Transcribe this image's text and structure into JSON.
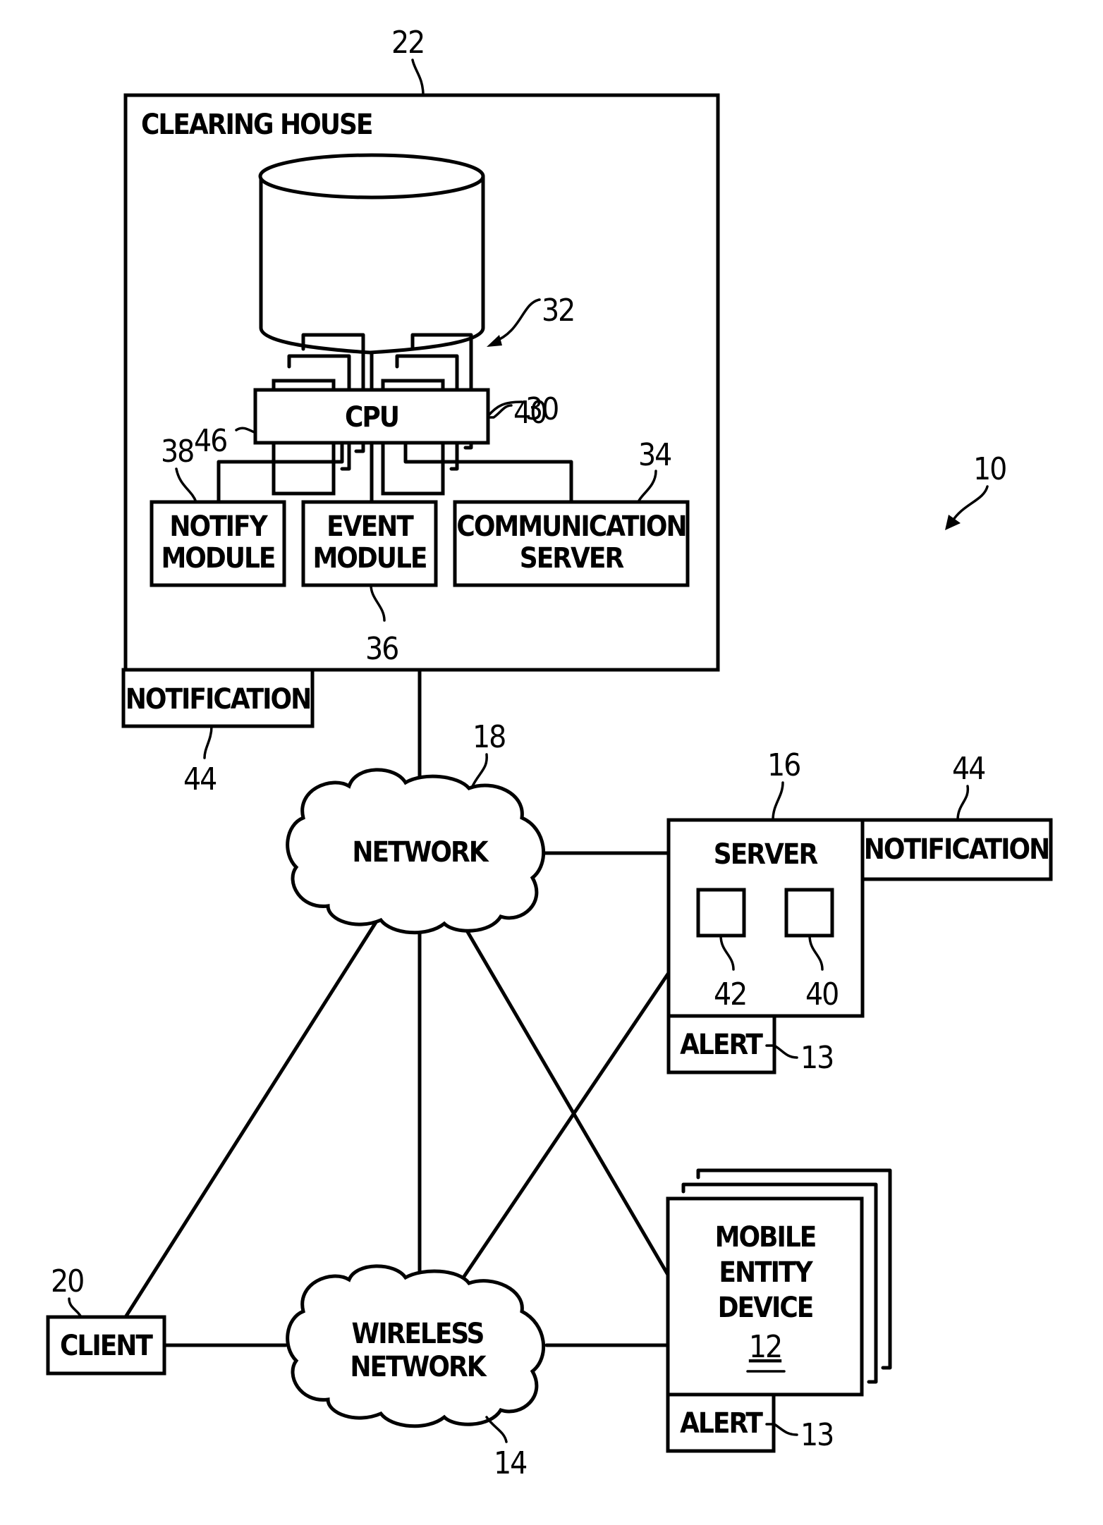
{
  "figure": {
    "ref": "10",
    "clearing_house": {
      "ref": "22",
      "title": "CLEARING HOUSE"
    },
    "database": {
      "ref": "32",
      "left_records_ref": "46",
      "right_records_ref": "40"
    },
    "cpu": {
      "ref": "30",
      "label": "CPU"
    },
    "notify_module": {
      "ref": "38",
      "line1": "NOTIFY",
      "line2": "MODULE"
    },
    "event_module": {
      "ref": "36",
      "line1": "EVENT",
      "line2": "MODULE"
    },
    "communication_server": {
      "ref": "34",
      "line1": "COMMUNICATION",
      "line2": "SERVER"
    },
    "notification_left": {
      "ref": "44",
      "label": "NOTIFICATION"
    },
    "network": {
      "ref": "18",
      "label": "NETWORK"
    },
    "server": {
      "ref": "16",
      "label": "SERVER",
      "item_left_ref": "42",
      "item_right_ref": "40"
    },
    "notification_right": {
      "ref": "44",
      "label": "NOTIFICATION"
    },
    "server_alert": {
      "ref": "13",
      "label": "ALERT"
    },
    "mobile_device": {
      "ref": "12",
      "line1": "MOBILE",
      "line2": "ENTITY",
      "line3": "DEVICE"
    },
    "mobile_alert": {
      "ref": "13",
      "label": "ALERT"
    },
    "client": {
      "ref": "20",
      "label": "CLIENT"
    },
    "wireless_network": {
      "ref": "14",
      "line1": "WIRELESS",
      "line2": "NETWORK"
    }
  }
}
